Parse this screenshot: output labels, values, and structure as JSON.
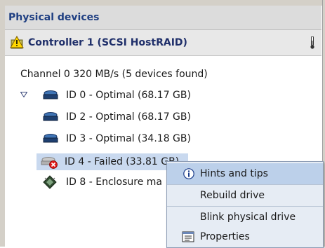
{
  "panel": {
    "title": "Physical devices"
  },
  "controller": {
    "label": "Controller 1 (SCSI HostRAID)"
  },
  "channel": {
    "label": "Channel 0  320 MB/s (5 devices found)"
  },
  "devices": [
    {
      "label": "ID 0 - Optimal (68.17 GB)",
      "status": "optimal",
      "icon": "hard-drive-icon"
    },
    {
      "label": "ID 2 - Optimal (68.17 GB)",
      "status": "optimal",
      "icon": "hard-drive-icon"
    },
    {
      "label": "ID 3 - Optimal (34.18 GB)",
      "status": "optimal",
      "icon": "hard-drive-icon"
    },
    {
      "label": "ID 4 - Failed (33.81 GB)",
      "status": "failed",
      "icon": "failed-drive-icon",
      "selected": true
    },
    {
      "label": "ID 8 - Enclosure ma",
      "status": "enclosure",
      "icon": "enclosure-icon"
    }
  ],
  "context_menu": {
    "items": [
      {
        "label": "Hints and tips",
        "icon": "info-icon",
        "highlighted": true
      },
      {
        "label": "Rebuild drive"
      },
      {
        "label": "Blink physical drive"
      },
      {
        "label": "Properties",
        "icon": "properties-icon"
      }
    ]
  },
  "colors": {
    "header_text": "#1f3f82",
    "selection": "#c9d9ef",
    "menu_bg": "#e6ecf4",
    "menu_highlight": "#bcd0ea",
    "failed_badge": "#e01818"
  }
}
